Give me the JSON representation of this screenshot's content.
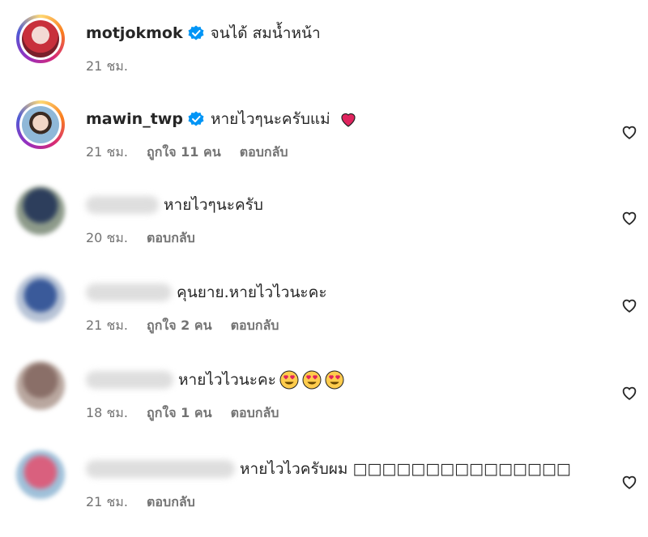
{
  "comments": [
    {
      "username": "motjokmok",
      "text": "จนได้ สมน้ำหน้า",
      "time": "21 ชม.",
      "likes": "",
      "reply": ""
    },
    {
      "username": "mawin_twp",
      "text": "หายไวๆนะครับแม่",
      "time": "21 ชม.",
      "likes": "ถูกใจ 11 คน",
      "reply": "ตอบกลับ"
    },
    {
      "username": "",
      "text": "หายไวๆนะครับ",
      "time": "20 ชม.",
      "likes": "",
      "reply": "ตอบกลับ"
    },
    {
      "username": "",
      "text": "คุนยาย.หายไวไวนะคะ",
      "time": "21 ชม.",
      "likes": "ถูกใจ 2 คน",
      "reply": "ตอบกลับ"
    },
    {
      "username": "",
      "text": "หายไวไวนะคะ",
      "time": "18 ชม.",
      "likes": "ถูกใจ 1 คน",
      "reply": "ตอบกลับ"
    },
    {
      "username": "",
      "text": "หายไวไวครับผม □□□□□□□□□□□□□□□",
      "time": "21 ชม.",
      "likes": "",
      "reply": "ตอบกลับ"
    }
  ],
  "colors": {
    "verified": "#0095f6",
    "heart_red": "#e0245e",
    "meta_gray": "#737373"
  },
  "icons": {
    "verified": "verified-badge-icon",
    "like": "heart-outline-icon",
    "red_heart": "red-heart-emoji",
    "heart_eyes": "heart-eyes-emoji"
  }
}
